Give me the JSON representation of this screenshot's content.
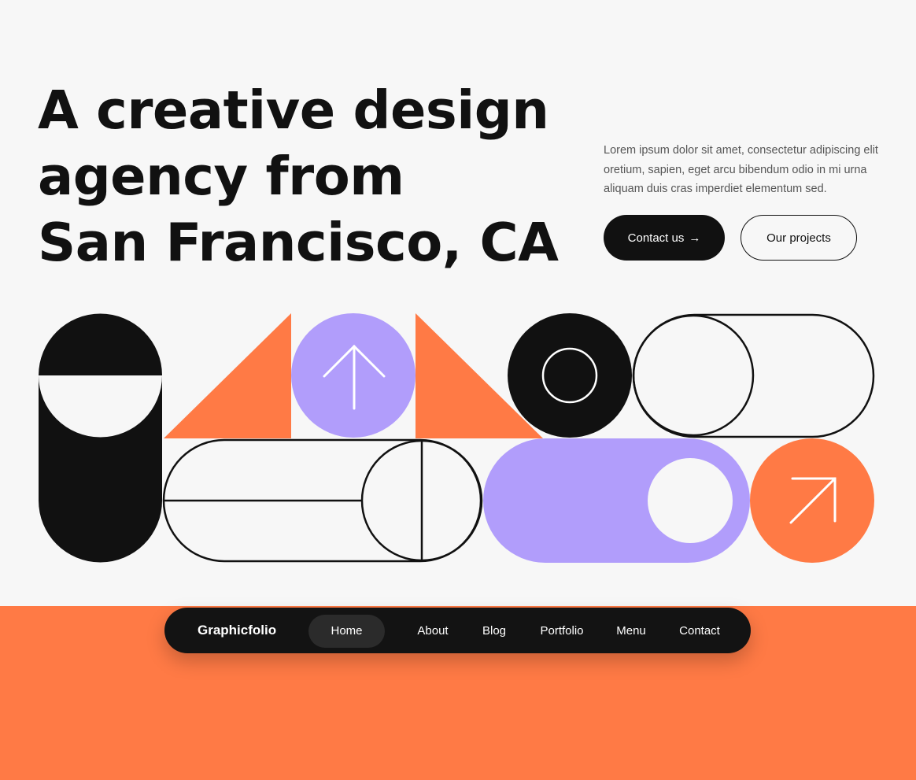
{
  "hero": {
    "title_lines": [
      "A creative design",
      "agency from",
      "San Francisco, CA"
    ],
    "description": "Lorem ipsum dolor sit amet, consectetur adipiscing elit oretium, sapien, eget arcu bibendum odio in mi urna aliquam duis cras imperdiet elementum sed.",
    "primary_button": {
      "label": "Contact us",
      "icon": "arrow-right-icon",
      "arrow": "→"
    },
    "secondary_button": {
      "label": "Our projects"
    }
  },
  "colors": {
    "background": "#f7f7f7",
    "ink": "#111111",
    "accent_orange": "#ff7a45",
    "accent_purple": "#b19dfb",
    "navbar": "#131313"
  },
  "shapes": {
    "icons": [
      "arrow-up-icon",
      "arrow-up-right-icon"
    ]
  },
  "navbar": {
    "brand": "Graphicfolio",
    "items": [
      {
        "label": "Home",
        "active": true
      },
      {
        "label": "About",
        "active": false
      },
      {
        "label": "Blog",
        "active": false
      },
      {
        "label": "Portfolio",
        "active": false
      },
      {
        "label": "Menu",
        "active": false
      },
      {
        "label": "Contact",
        "active": false
      }
    ]
  }
}
